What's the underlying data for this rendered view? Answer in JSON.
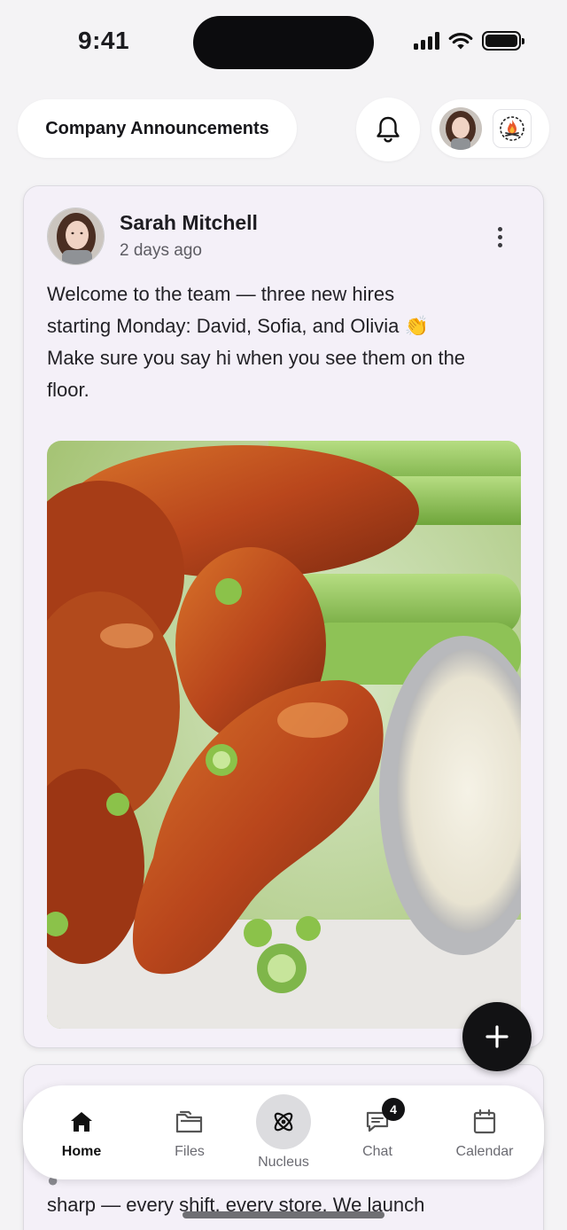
{
  "status_bar": {
    "time": "9:41"
  },
  "header": {
    "channel_title": "Company Announcements",
    "icons": {
      "notifications": "bell-icon",
      "org_logo": "campfire-icon"
    }
  },
  "post": {
    "author": "Sarah Mitchell",
    "time_ago": "2 days ago",
    "body_lines": [
      "Welcome to the team — three new hires",
      "starting Monday: David, Sofia, and Olivia 👏",
      "Make sure you say hi when you see them on the",
      "floor."
    ]
  },
  "next_post": {
    "partial_line_1": "sharp — every shift, every store. We launch"
  },
  "bottom_nav": {
    "items": [
      {
        "label": "Home",
        "icon": "home-icon",
        "active": true
      },
      {
        "label": "Files",
        "icon": "folder-icon"
      },
      {
        "label": "Nucleus",
        "icon": "atom-icon"
      },
      {
        "label": "Chat",
        "icon": "chat-icon",
        "badge": "4"
      },
      {
        "label": "Calendar",
        "icon": "calendar-icon"
      }
    ]
  },
  "colors": {
    "accent": "#121214",
    "card_bg": "#f4f0f8",
    "page_bg": "#f4f3f5"
  }
}
